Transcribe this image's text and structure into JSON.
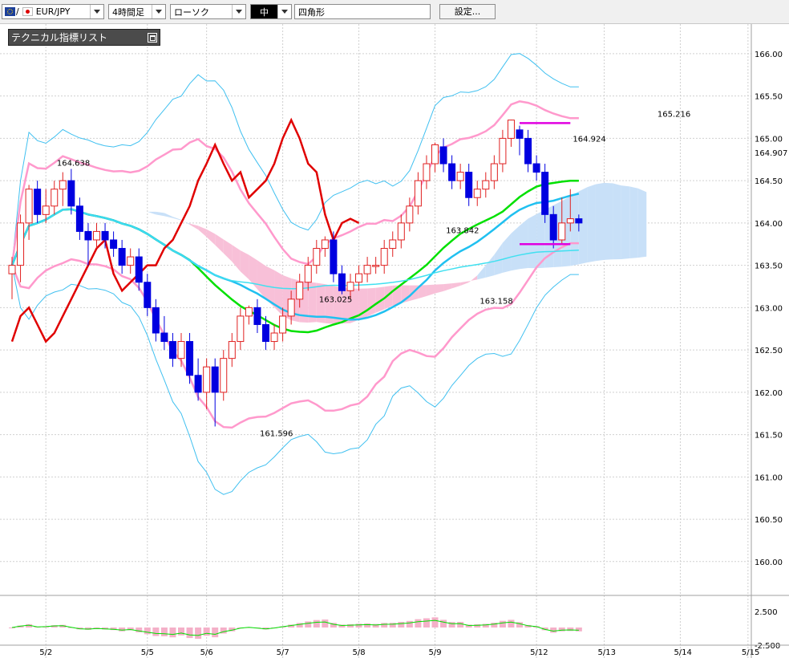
{
  "toolbar": {
    "pair": {
      "value": "EUR/JPY",
      "separator": "/"
    },
    "period": "4時間足",
    "chart_type": "ローソク",
    "line_width": "中",
    "shape": "四角形",
    "settings_button": "設定..."
  },
  "indicator_list": {
    "label": "テクニカル指標リスト",
    "icon": "restore-window-icon"
  },
  "price_axis": [
    "166.00",
    "165.50",
    "165.00",
    "164.50",
    "164.00",
    "163.50",
    "163.00",
    "162.50",
    "162.00",
    "161.50",
    "161.00",
    "160.50",
    "160.00"
  ],
  "current_price": "164.907",
  "oscillator_axis": [
    "2.500",
    "-2.500"
  ],
  "date_axis": [
    {
      "label": "5/2",
      "i": 4
    },
    {
      "label": "5/5",
      "i": 16
    },
    {
      "label": "5/6",
      "i": 23
    },
    {
      "label": "5/7",
      "i": 32
    },
    {
      "label": "5/8",
      "i": 41
    },
    {
      "label": "5/9",
      "i": 50
    },
    {
      "label": "5/12",
      "i": 62
    },
    {
      "label": "5/13",
      "i": 70
    },
    {
      "label": "5/14",
      "i": 79
    },
    {
      "label": "5/15",
      "i": 87
    }
  ],
  "colors": {
    "bull": "#e02020",
    "bear": "#0000e0",
    "ma_short": "#00e000",
    "ma_long": "#20c0f0",
    "ma_longer": "#40e0f0",
    "bollinger_2": "#ff99cc",
    "bollinger_3": "#40c0f0",
    "chikou": "#e00000",
    "cloud_up": "#c8e0f8",
    "cloud_down": "#f8c0d8",
    "drawn_rect": "#e000e0"
  },
  "chart_data": {
    "type": "candlestick",
    "symbol": "EUR/JPY",
    "timeframe": "4時間足",
    "ylim": [
      159.6,
      166.35
    ],
    "annotations": [
      {
        "text": "164.638",
        "x": 7,
        "price": 164.638
      },
      {
        "text": "161.596",
        "x": 31,
        "price": 161.596
      },
      {
        "text": "163.025",
        "x": 38,
        "price": 163.025
      },
      {
        "text": "163.842",
        "x": 53,
        "price": 163.842
      },
      {
        "text": "163.158",
        "x": 57,
        "price": 163.158
      },
      {
        "text": "164.924",
        "x": 68,
        "price": 164.924
      },
      {
        "text": "165.216",
        "x": 78,
        "price": 165.216
      }
    ],
    "candles": [
      [
        163.4,
        163.5,
        163.1,
        163.6
      ],
      [
        163.5,
        164.0,
        163.3,
        164.1
      ],
      [
        164.0,
        164.4,
        163.8,
        164.45
      ],
      [
        164.4,
        164.1,
        164.0,
        164.5
      ],
      [
        164.1,
        164.2,
        164.0,
        164.4
      ],
      [
        164.2,
        164.4,
        164.1,
        164.5
      ],
      [
        164.4,
        164.5,
        164.2,
        164.6
      ],
      [
        164.5,
        164.2,
        164.1,
        164.638
      ],
      [
        164.2,
        163.9,
        163.8,
        164.3
      ],
      [
        163.9,
        163.8,
        163.5,
        164.0
      ],
      [
        163.8,
        163.9,
        163.7,
        164.0
      ],
      [
        163.9,
        163.8,
        163.7,
        164.0
      ],
      [
        163.8,
        163.7,
        163.6,
        163.9
      ],
      [
        163.7,
        163.5,
        163.4,
        163.8
      ],
      [
        163.5,
        163.6,
        163.4,
        163.7
      ],
      [
        163.6,
        163.3,
        163.2,
        163.7
      ],
      [
        163.3,
        163.0,
        162.9,
        163.4
      ],
      [
        163.0,
        162.7,
        162.6,
        163.1
      ],
      [
        162.7,
        162.6,
        162.5,
        162.9
      ],
      [
        162.6,
        162.4,
        162.3,
        162.7
      ],
      [
        162.4,
        162.6,
        162.3,
        162.7
      ],
      [
        162.6,
        162.2,
        162.1,
        162.7
      ],
      [
        162.2,
        162.0,
        161.9,
        162.4
      ],
      [
        162.0,
        162.3,
        161.8,
        162.4
      ],
      [
        162.3,
        162.0,
        161.596,
        162.4
      ],
      [
        162.0,
        162.4,
        161.9,
        162.5
      ],
      [
        162.4,
        162.6,
        162.3,
        162.7
      ],
      [
        162.6,
        162.9,
        162.5,
        163.0
      ],
      [
        162.9,
        163.0,
        162.8,
        163.025
      ],
      [
        163.0,
        162.8,
        162.7,
        163.1
      ],
      [
        162.8,
        162.6,
        162.5,
        162.9
      ],
      [
        162.6,
        162.7,
        162.5,
        162.8
      ],
      [
        162.7,
        162.9,
        162.6,
        163.0
      ],
      [
        162.9,
        163.1,
        162.8,
        163.2
      ],
      [
        163.1,
        163.3,
        163.0,
        163.4
      ],
      [
        163.3,
        163.5,
        163.2,
        163.6
      ],
      [
        163.5,
        163.7,
        163.4,
        163.8
      ],
      [
        163.7,
        163.8,
        163.6,
        163.842
      ],
      [
        163.8,
        163.4,
        163.3,
        163.9
      ],
      [
        163.4,
        163.2,
        163.158,
        163.5
      ],
      [
        163.2,
        163.3,
        163.1,
        163.4
      ],
      [
        163.3,
        163.4,
        163.2,
        163.5
      ],
      [
        163.4,
        163.5,
        163.3,
        163.6
      ],
      [
        163.5,
        163.5,
        163.4,
        163.6
      ],
      [
        163.5,
        163.7,
        163.4,
        163.8
      ],
      [
        163.7,
        163.8,
        163.6,
        163.9
      ],
      [
        163.8,
        164.0,
        163.7,
        164.1
      ],
      [
        164.0,
        164.2,
        163.9,
        164.3
      ],
      [
        164.2,
        164.5,
        164.1,
        164.6
      ],
      [
        164.5,
        164.7,
        164.4,
        164.8
      ],
      [
        164.7,
        164.924,
        164.6,
        164.95
      ],
      [
        164.9,
        164.7,
        164.6,
        165.0
      ],
      [
        164.7,
        164.5,
        164.4,
        164.8
      ],
      [
        164.5,
        164.6,
        164.4,
        164.7
      ],
      [
        164.6,
        164.3,
        164.2,
        164.7
      ],
      [
        164.3,
        164.4,
        164.2,
        164.5
      ],
      [
        164.4,
        164.5,
        164.3,
        164.6
      ],
      [
        164.5,
        164.7,
        164.4,
        164.8
      ],
      [
        164.7,
        165.0,
        164.6,
        165.1
      ],
      [
        165.0,
        165.216,
        164.9,
        165.22
      ],
      [
        165.1,
        165.0,
        164.8,
        165.15
      ],
      [
        165.0,
        164.7,
        164.6,
        165.1
      ],
      [
        164.7,
        164.6,
        164.5,
        164.8
      ],
      [
        164.6,
        164.1,
        164.0,
        164.7
      ],
      [
        164.1,
        163.8,
        163.7,
        164.2
      ],
      [
        163.8,
        164.0,
        163.75,
        164.3
      ],
      [
        164.0,
        164.05,
        163.9,
        164.4
      ],
      [
        164.05,
        164.0,
        163.9,
        164.1
      ]
    ]
  }
}
